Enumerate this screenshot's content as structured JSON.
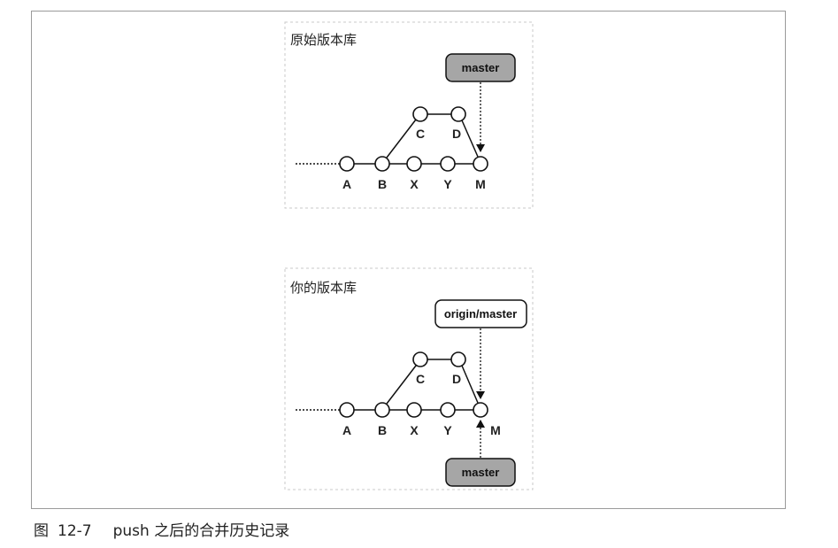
{
  "figure": {
    "caption_prefix": "图",
    "caption_number": "12-7",
    "caption_text": "push 之后的合并历史记录"
  },
  "panels": [
    {
      "title": "原始版本库",
      "refs": [
        {
          "label": "master",
          "style": "filled",
          "color": "#a6a6a6"
        }
      ],
      "nodes": [
        "A",
        "B",
        "X",
        "Y",
        "M",
        "C",
        "D"
      ]
    },
    {
      "title": "你的版本库",
      "refs": [
        {
          "label": "origin/master",
          "style": "outline",
          "color": "#ffffff"
        },
        {
          "label": "master",
          "style": "filled",
          "color": "#a6a6a6"
        }
      ],
      "nodes": [
        "A",
        "B",
        "X",
        "Y",
        "M",
        "C",
        "D"
      ]
    }
  ]
}
